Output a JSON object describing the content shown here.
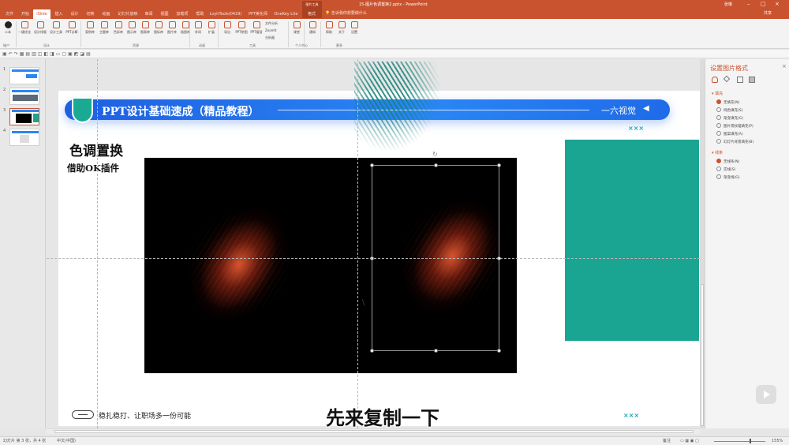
{
  "window": {
    "doc_title": "15-图片色调置换2.pptx  -  PowerPoint",
    "context_tool": "图片工具",
    "context_tab": "格式",
    "tell_me": "告诉我你想要做什么",
    "user": "张琳",
    "share": "共享"
  },
  "tabs": [
    "文件",
    "开始",
    "iSlide",
    "插入",
    "设计",
    "切换",
    "动画",
    "幻灯片放映",
    "审阅",
    "视图",
    "加载项",
    "帮助",
    "LvyhTools(0429)",
    "PPT美化师",
    "OneKey Lite"
  ],
  "active_tab": "iSlide",
  "ribbon": {
    "buttons": [
      "二本",
      "一键优化",
      "设计排版",
      "设计工具",
      "PPT诊断",
      "案例库",
      "主题库",
      "色彩库",
      "图示库",
      "图表库",
      "图标库",
      "图片库",
      "插图库",
      "补间",
      "扩展",
      "导出",
      "PPT拼图",
      "PPT瘦身",
      "课堂",
      "通知",
      "帮助",
      "关于",
      "设置"
    ],
    "small_items": [
      "文件分析",
      "ZoomIt",
      "分析器"
    ],
    "groups": [
      "账户",
      "设计",
      "资源",
      "动画",
      "工具",
      "个人中心",
      "更多"
    ]
  },
  "slides": {
    "numbers": [
      "1",
      "2",
      "3",
      "4"
    ],
    "selected": "3"
  },
  "slide": {
    "banner_title": "PPT设计基础速成（精品教程）",
    "banner_brand": "一六视觉",
    "banner_arrow": "◀",
    "xmark": "×××",
    "heading": "色调置换",
    "subheading": "借助OK插件",
    "footer_text": "稳扎稳打、让职场多一份可能",
    "accent": "#1aa593",
    "banner_color": "#2a86f5"
  },
  "subtitle": "先来复制一下",
  "format_pane": {
    "title": "设置图片格式",
    "close": "×",
    "fill_section": "填充",
    "fill_options": [
      "无填充(N)",
      "纯色填充(S)",
      "渐变填充(G)",
      "图片或纹理填充(P)",
      "图案填充(A)",
      "幻灯片背景填充(B)"
    ],
    "line_section": "线条",
    "line_options": [
      "无线条(N)",
      "实线(S)",
      "渐变线(G)"
    ]
  },
  "statusbar": {
    "slide_info": "幻灯片 第 3 张，共 4 张",
    "language": "中文(中国)",
    "notes": "备注",
    "zoom": "155%"
  },
  "colors": {
    "brand": "#c9532f",
    "teal": "#1aa593"
  }
}
